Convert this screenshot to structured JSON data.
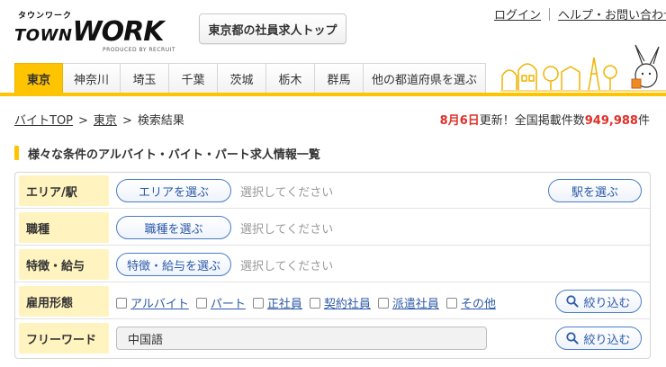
{
  "logo": {
    "kana": "タウンワーク",
    "town": "TOWN",
    "work": "WORK",
    "produced": "PRODUCED BY RECRUIT"
  },
  "header": {
    "top_button": "東京都の社員求人トップ",
    "login": "ログイン",
    "help": "ヘルプ・お問い合わせ"
  },
  "nav": {
    "items": [
      "東京",
      "神奈川",
      "埼玉",
      "千葉",
      "茨城",
      "栃木",
      "群馬",
      "他の都道府県を選ぶ"
    ],
    "active_index": 0
  },
  "breadcrumb": {
    "home": "バイトTOP",
    "region": "東京",
    "current": "検索結果",
    "arrow": ">"
  },
  "update": {
    "date": "8月6日",
    "text1": "更新！全国掲載件数",
    "count": "949,988",
    "unit": "件"
  },
  "section_title": "様々な条件のアルバイト・バイト・パート求人情報一覧",
  "search": {
    "area": {
      "label": "エリア/駅",
      "button": "エリアを選ぶ",
      "placeholder": "選択してください",
      "station_button": "駅を選ぶ"
    },
    "job": {
      "label": "職種",
      "button": "職種を選ぶ",
      "placeholder": "選択してください"
    },
    "feature": {
      "label": "特徴・給与",
      "button": "特徴・給与を選ぶ",
      "placeholder": "選択してください"
    },
    "employment": {
      "label": "雇用形態",
      "options": [
        "アルバイト",
        "パート",
        "正社員",
        "契約社員",
        "派遣社員",
        "その他"
      ],
      "narrow_button": "絞り込む"
    },
    "freeword": {
      "label": "フリーワード",
      "value": "中国語",
      "narrow_button": "絞り込む"
    }
  },
  "colors": {
    "accent_yellow": "#ffc400",
    "link_blue": "#2d5aa8",
    "highlight_red": "#e0302a"
  }
}
